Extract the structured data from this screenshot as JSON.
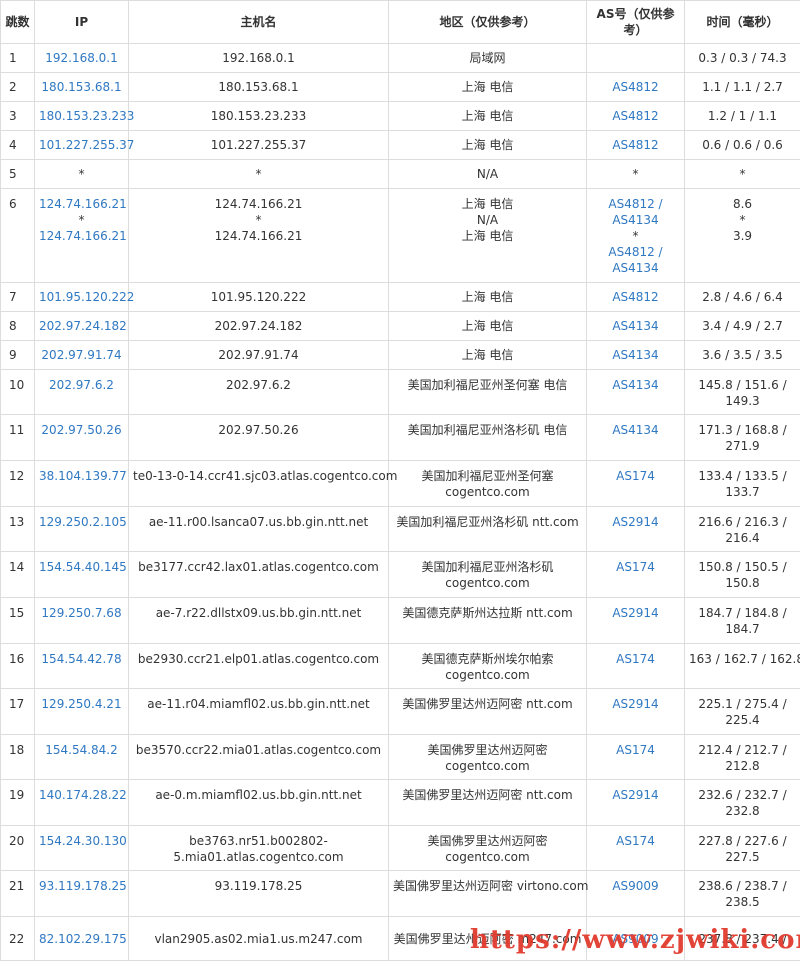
{
  "table": {
    "headers": [
      "跳数",
      "IP",
      "主机名",
      "地区（仅供参考）",
      "AS号（仅供参考）",
      "时间（毫秒）"
    ],
    "rows": [
      {
        "hop": "1",
        "ip": [
          "192.168.0.1"
        ],
        "host": [
          "192.168.0.1"
        ],
        "region": [
          "局域网"
        ],
        "as": [
          ""
        ],
        "time": [
          "0.3 / 0.3 / 74.3"
        ]
      },
      {
        "hop": "2",
        "ip": [
          "180.153.68.1"
        ],
        "host": [
          "180.153.68.1"
        ],
        "region": [
          "上海 电信"
        ],
        "as": [
          "AS4812"
        ],
        "time": [
          "1.1 / 1.1 / 2.7"
        ]
      },
      {
        "hop": "3",
        "ip": [
          "180.153.23.233"
        ],
        "host": [
          "180.153.23.233"
        ],
        "region": [
          "上海 电信"
        ],
        "as": [
          "AS4812"
        ],
        "time": [
          "1.2 / 1 / 1.1"
        ]
      },
      {
        "hop": "4",
        "ip": [
          "101.227.255.37"
        ],
        "host": [
          "101.227.255.37"
        ],
        "region": [
          "上海 电信"
        ],
        "as": [
          "AS4812"
        ],
        "time": [
          "0.6 / 0.6 / 0.6"
        ]
      },
      {
        "hop": "5",
        "ip": [
          "*"
        ],
        "host": [
          "*"
        ],
        "region": [
          "N/A"
        ],
        "as": [
          "*"
        ],
        "time": [
          "*"
        ]
      },
      {
        "hop": "6",
        "ip": [
          "124.74.166.21",
          "*",
          "124.74.166.21"
        ],
        "host": [
          "124.74.166.21",
          "*",
          "124.74.166.21"
        ],
        "region": [
          "上海 电信",
          "N/A",
          "上海 电信"
        ],
        "as": [
          "AS4812 /",
          "AS4134",
          "*",
          "AS4812 /",
          "AS4134"
        ],
        "time": [
          "8.6",
          "*",
          "3.9"
        ]
      },
      {
        "hop": "7",
        "ip": [
          "101.95.120.222"
        ],
        "host": [
          "101.95.120.222"
        ],
        "region": [
          "上海 电信"
        ],
        "as": [
          "AS4812"
        ],
        "time": [
          "2.8 / 4.6 / 6.4"
        ]
      },
      {
        "hop": "8",
        "ip": [
          "202.97.24.182"
        ],
        "host": [
          "202.97.24.182"
        ],
        "region": [
          "上海 电信"
        ],
        "as": [
          "AS4134"
        ],
        "time": [
          "3.4 / 4.9 / 2.7"
        ]
      },
      {
        "hop": "9",
        "ip": [
          "202.97.91.74"
        ],
        "host": [
          "202.97.91.74"
        ],
        "region": [
          "上海 电信"
        ],
        "as": [
          "AS4134"
        ],
        "time": [
          "3.6 / 3.5 / 3.5"
        ]
      },
      {
        "hop": "10",
        "ip": [
          "202.97.6.2"
        ],
        "host": [
          "202.97.6.2"
        ],
        "region": [
          "美国加利福尼亚州圣何塞 电信"
        ],
        "as": [
          "AS4134"
        ],
        "time": [
          "145.8 / 151.6 /",
          "149.3"
        ]
      },
      {
        "hop": "11",
        "ip": [
          "202.97.50.26"
        ],
        "host": [
          "202.97.50.26"
        ],
        "region": [
          "美国加利福尼亚州洛杉矶 电信"
        ],
        "as": [
          "AS4134"
        ],
        "time": [
          "171.3 / 168.8 /",
          "271.9"
        ]
      },
      {
        "hop": "12",
        "ip": [
          "38.104.139.77"
        ],
        "host": [
          "te0-13-0-14.ccr41.sjc03.atlas.cogentco.com"
        ],
        "region": [
          "美国加利福尼亚州圣何塞",
          "cogentco.com"
        ],
        "as": [
          "AS174"
        ],
        "time": [
          "133.4 / 133.5 /",
          "133.7"
        ]
      },
      {
        "hop": "13",
        "ip": [
          "129.250.2.105"
        ],
        "host": [
          "ae-11.r00.lsanca07.us.bb.gin.ntt.net"
        ],
        "region": [
          "美国加利福尼亚州洛杉矶 ntt.com"
        ],
        "as": [
          "AS2914"
        ],
        "time": [
          "216.6 / 216.3 /",
          "216.4"
        ]
      },
      {
        "hop": "14",
        "ip": [
          "154.54.40.145"
        ],
        "host": [
          "be3177.ccr42.lax01.atlas.cogentco.com"
        ],
        "region": [
          "美国加利福尼亚州洛杉矶",
          "cogentco.com"
        ],
        "as": [
          "AS174"
        ],
        "time": [
          "150.8 / 150.5 /",
          "150.8"
        ]
      },
      {
        "hop": "15",
        "ip": [
          "129.250.7.68"
        ],
        "host": [
          "ae-7.r22.dllstx09.us.bb.gin.ntt.net"
        ],
        "region": [
          "美国德克萨斯州达拉斯 ntt.com"
        ],
        "as": [
          "AS2914"
        ],
        "time": [
          "184.7 / 184.8 /",
          "184.7"
        ]
      },
      {
        "hop": "16",
        "ip": [
          "154.54.42.78"
        ],
        "host": [
          "be2930.ccr21.elp01.atlas.cogentco.com"
        ],
        "region": [
          "美国德克萨斯州埃尔帕索",
          "cogentco.com"
        ],
        "as": [
          "AS174"
        ],
        "time": [
          "163 / 162.7 / 162.8"
        ]
      },
      {
        "hop": "17",
        "ip": [
          "129.250.4.21"
        ],
        "host": [
          "ae-11.r04.miamfl02.us.bb.gin.ntt.net"
        ],
        "region": [
          "美国佛罗里达州迈阿密 ntt.com"
        ],
        "as": [
          "AS2914"
        ],
        "time": [
          "225.1 / 275.4 /",
          "225.4"
        ]
      },
      {
        "hop": "18",
        "ip": [
          "154.54.84.2"
        ],
        "host": [
          "be3570.ccr22.mia01.atlas.cogentco.com"
        ],
        "region": [
          "美国佛罗里达州迈阿密",
          "cogentco.com"
        ],
        "as": [
          "AS174"
        ],
        "time": [
          "212.4 / 212.7 /",
          "212.8"
        ]
      },
      {
        "hop": "19",
        "ip": [
          "140.174.28.22"
        ],
        "host": [
          "ae-0.m.miamfl02.us.bb.gin.ntt.net"
        ],
        "region": [
          "美国佛罗里达州迈阿密 ntt.com"
        ],
        "as": [
          "AS2914"
        ],
        "time": [
          "232.6 / 232.7 /",
          "232.8"
        ]
      },
      {
        "hop": "20",
        "ip": [
          "154.24.30.130"
        ],
        "host": [
          "be3763.nr51.b002802-",
          "5.mia01.atlas.cogentco.com"
        ],
        "region": [
          "美国佛罗里达州迈阿密",
          "cogentco.com"
        ],
        "as": [
          "AS174"
        ],
        "time": [
          "227.8 / 227.6 /",
          "227.5"
        ]
      },
      {
        "hop": "21",
        "ip": [
          "93.119.178.25"
        ],
        "host": [
          "93.119.178.25"
        ],
        "region": [
          "美国佛罗里达州迈阿密 virtono.com"
        ],
        "as": [
          "AS9009"
        ],
        "time": [
          "238.6 / 238.7 /",
          "238.5"
        ]
      },
      {
        "hop": "22",
        "ip": [
          "82.102.29.175"
        ],
        "host": [
          "vlan2905.as02.mia1.us.m247.com"
        ],
        "region": [
          "美国佛罗里达州迈阿密 m247.com"
        ],
        "as": [
          "AS9009"
        ],
        "time": [
          "237.8 / 237.4 /"
        ]
      }
    ]
  },
  "watermark": {
    "text": "https://www.zjwiki.com",
    "color": "#e23b2e"
  },
  "colors": {
    "link": "#2f78c2",
    "border": "#dddddd",
    "text": "#333333"
  }
}
